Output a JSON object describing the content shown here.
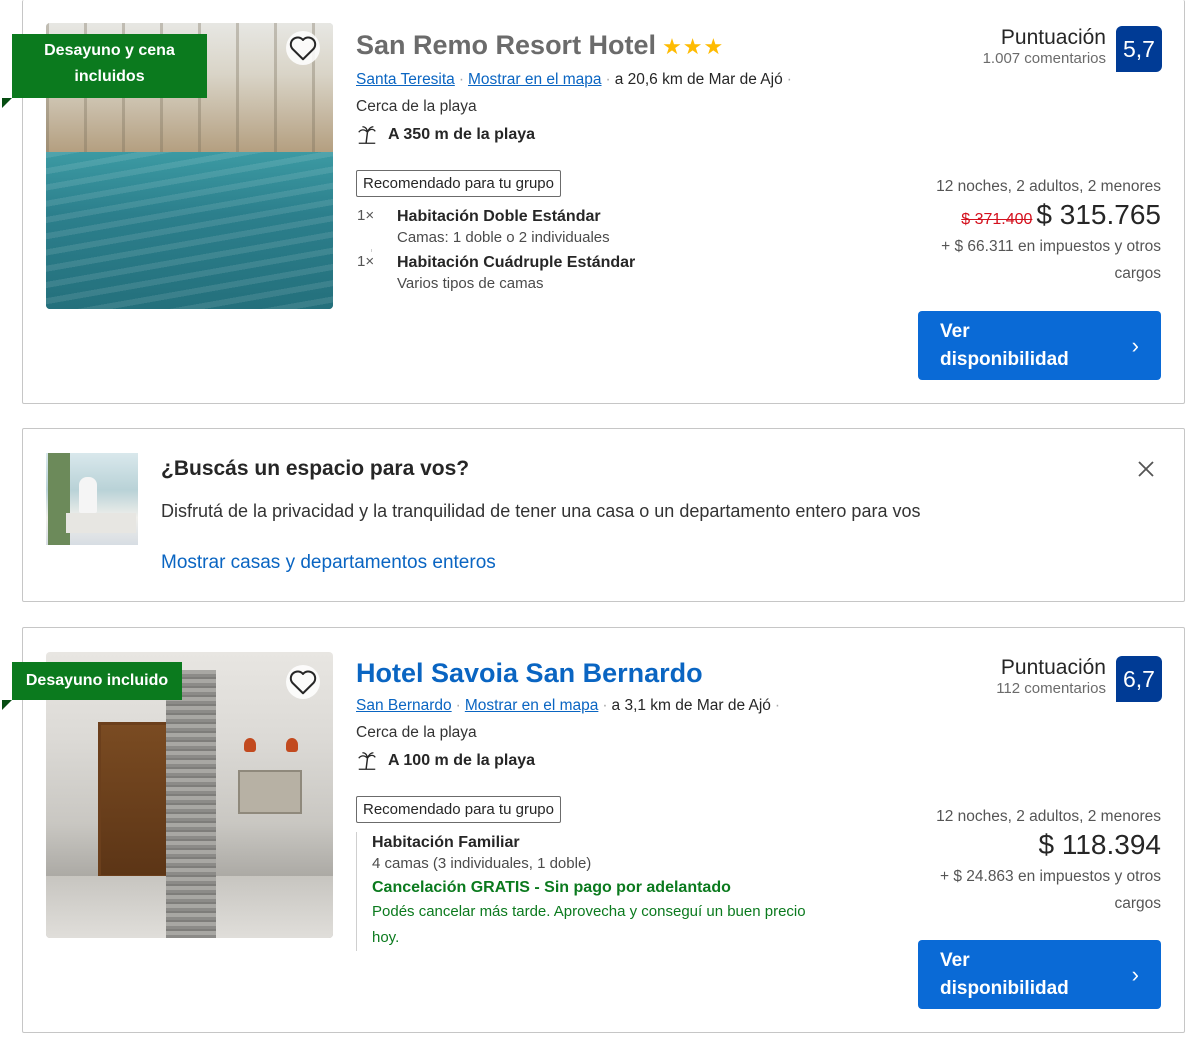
{
  "listings": [
    {
      "ribbon": "Desayuno y cena incluidos",
      "title": "San Remo Resort Hotel",
      "stars": "★★★",
      "city_link": "Santa Teresita",
      "map_link": "Mostrar en el mapa",
      "distance": "a 20,6 km de Mar de Ajó",
      "near": "Cerca de la playa",
      "beach": "A 350 m de la playa",
      "recommended": "Recomendado para tu grupo",
      "rooms": [
        {
          "qty": "1×",
          "name": "Habitación Doble Estándar",
          "beds": "Camas: 1 doble o 2 individuales"
        },
        {
          "qty": "1×",
          "name": "Habitación Cuádruple Estándar",
          "beds": "Varios tipos de camas"
        }
      ],
      "score_label": "Puntuación",
      "reviews": "1.007 comentarios",
      "score": "5,7",
      "stay": "12 noches, 2 adultos, 2 menores",
      "old_price": "$ 371.400",
      "price": "$ 315.765",
      "taxes": "+ $ 66.311 en impuestos y otros cargos",
      "button": "Ver disponibilidad"
    },
    {
      "ribbon": "Desayuno incluido",
      "title": "Hotel Savoia San Bernardo",
      "city_link": "San Bernardo",
      "map_link": "Mostrar en el mapa",
      "distance": "a 3,1 km de Mar de Ajó",
      "near": "Cerca de la playa",
      "beach": "A 100 m de la playa",
      "recommended": "Recomendado para tu grupo",
      "room_name": "Habitación Familiar",
      "room_beds": "4 camas (3 individuales, 1 doble)",
      "free_cancel": "Cancelación GRATIS - Sin pago por adelantado",
      "free_cancel_sub": "Podés cancelar más tarde. Aprovecha y conseguí un buen precio hoy.",
      "score_label": "Puntuación",
      "reviews": "112 comentarios",
      "score": "6,7",
      "stay": "12 noches, 2 adultos, 2 menores",
      "price": "$ 118.394",
      "taxes": "+ $ 24.863 en impuestos y otros cargos",
      "button": "Ver disponibilidad"
    }
  ],
  "promo": {
    "title": "¿Buscás un espacio para vos?",
    "text": "Disfrutá de la privacidad y la tranquilidad de tener una casa o un departamento entero para vos",
    "link": "Mostrar casas y departamentos enteros"
  },
  "icons": {
    "heart": "heart-icon",
    "close": "close-icon",
    "beach": "palm-tree-icon",
    "chevron": "chevron-right-icon"
  },
  "colors": {
    "primary_blue": "#0a6ad6",
    "link_blue": "#0a65c2",
    "score_badge": "#003b95",
    "ribbon_green": "#0b7a1e",
    "strike_red": "#d4111e",
    "star_yellow": "#febb02"
  }
}
